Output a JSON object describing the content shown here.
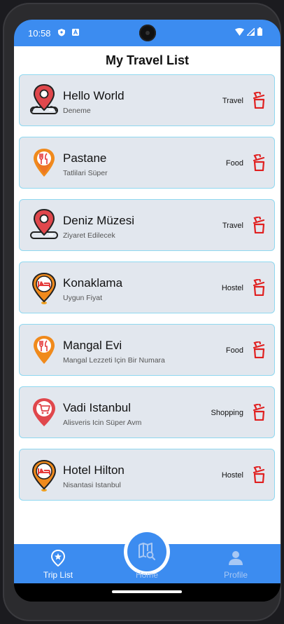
{
  "status_bar": {
    "time": "10:58"
  },
  "header": {
    "title": "My Travel List"
  },
  "places": [
    {
      "name": "Hello World",
      "description": "Deneme",
      "category": "Travel",
      "icon": "map-pin-travel-icon"
    },
    {
      "name": "Pastane",
      "description": "Tatlilari Süper",
      "category": "Food",
      "icon": "food-pin-icon"
    },
    {
      "name": "Deniz Müzesi",
      "description": "Ziyaret Edilecek",
      "category": "Travel",
      "icon": "map-pin-travel-icon"
    },
    {
      "name": "Konaklama",
      "description": "Uygun Fiyat",
      "category": "Hostel",
      "icon": "hostel-pin-icon"
    },
    {
      "name": "Mangal Evi",
      "description": "Mangal Lezzeti Için Bir Numara",
      "category": "Food",
      "icon": "food-pin-icon"
    },
    {
      "name": "Vadi Istanbul",
      "description": "Alisveris Icin Süper Avm",
      "category": "Shopping",
      "icon": "shopping-pin-icon"
    },
    {
      "name": "Hotel Hilton",
      "description": "Nisantasi Istanbul",
      "category": "Hostel",
      "icon": "hostel-pin-icon"
    }
  ],
  "bottom_nav": {
    "items": [
      {
        "label": "Trip List",
        "active": true
      },
      {
        "label": "Home",
        "active": false
      },
      {
        "label": "Profile",
        "active": false
      }
    ]
  },
  "colors": {
    "accent": "#3c8cf0",
    "card_bg": "#e2e7ee",
    "card_border": "#8fd8f0",
    "delete_red": "#e02020",
    "inactive_nav": "#a8c8f4"
  }
}
